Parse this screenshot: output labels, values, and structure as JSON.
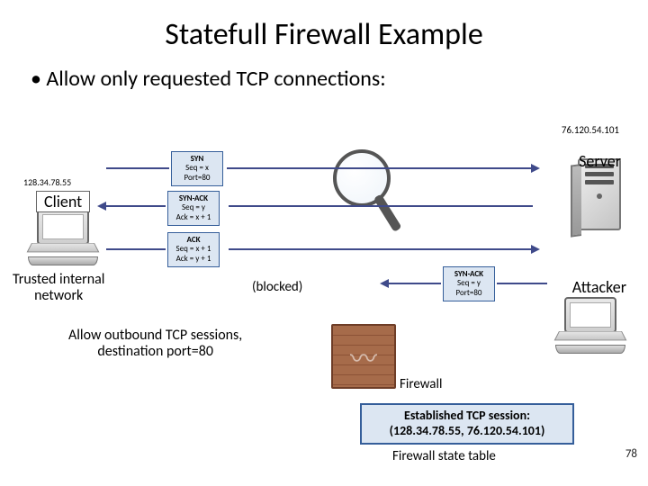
{
  "title": "Statefull Firewall Example",
  "bullet": "Allow only requested TCP connections:",
  "client_ip": "128.34.78.55",
  "server_ip": "76.120.54.101",
  "client_label": "Client",
  "server_label": "Server",
  "attacker_label": "Attacker",
  "trusted_label_l1": "Trusted internal",
  "trusted_label_l2": "network",
  "pkt_syn": {
    "l1": "SYN",
    "l2": "Seq = x",
    "l3": "Port=80"
  },
  "pkt_synack": {
    "l1": "SYN-ACK",
    "l2": "Seq = y",
    "l3": "Ack = x + 1"
  },
  "pkt_ack": {
    "l1": "ACK",
    "l2": "Seq = x + 1",
    "l3": "Ack = y + 1"
  },
  "pkt_attacker": {
    "l1": "SYN-ACK",
    "l2": "Seq = y",
    "l3": "Port=80"
  },
  "blocked": "(blocked)",
  "allow_l1": "Allow outbound TCP sessions,",
  "allow_l2": "destination port=80",
  "firewall_label": "Firewall",
  "established_l1": "Established TCP session:",
  "established_l2": "(128.34.78.55, 76.120.54.101)",
  "state_table_label": "Firewall state table",
  "page_number": "78"
}
